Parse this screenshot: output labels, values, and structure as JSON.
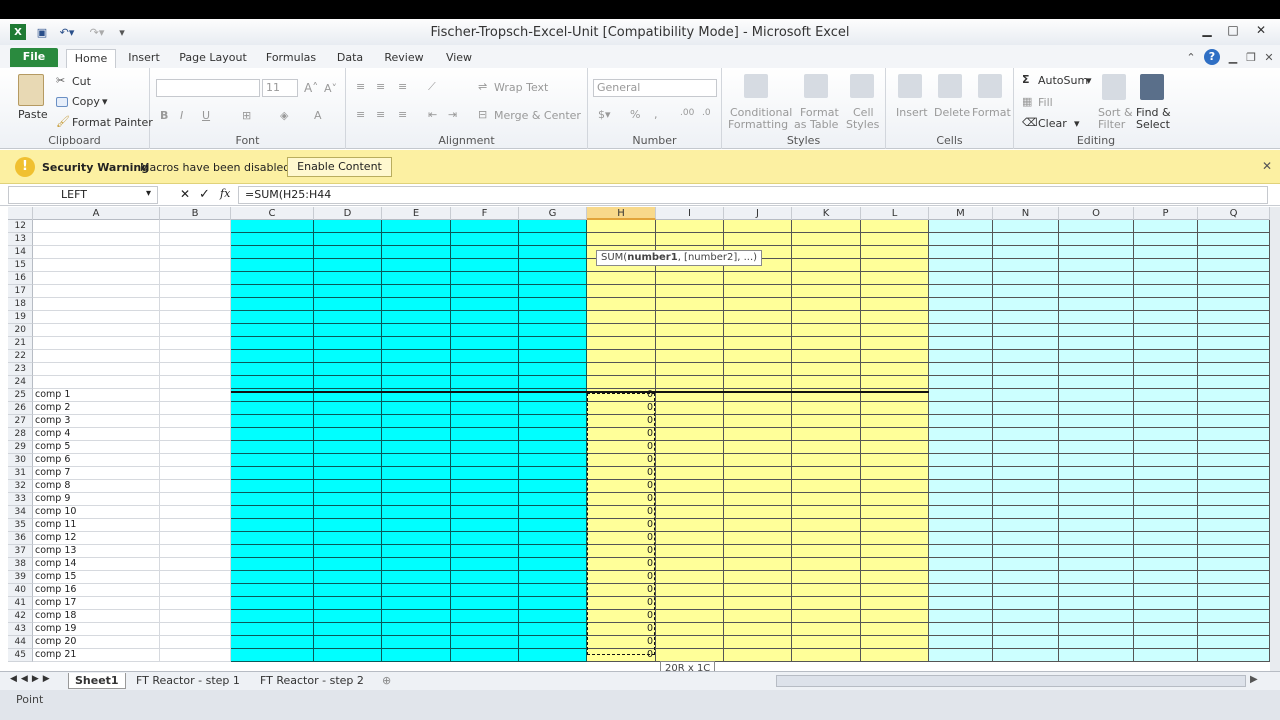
{
  "title": "Fischer-Tropsch-Excel-Unit  [Compatibility Mode] - Microsoft Excel",
  "tabs": [
    "File",
    "Home",
    "Insert",
    "Page Layout",
    "Formulas",
    "Data",
    "Review",
    "View"
  ],
  "ribbon": {
    "clipboard": {
      "paste": "Paste",
      "cut": "Cut",
      "copy": "Copy",
      "painter": "Format Painter",
      "label": "Clipboard"
    },
    "font": {
      "size": "11",
      "label": "Font"
    },
    "alignment": {
      "wrap": "Wrap Text",
      "merge": "Merge & Center",
      "label": "Alignment"
    },
    "number": {
      "format": "General",
      "label": "Number"
    },
    "styles": {
      "cond1": "Conditional",
      "cond2": "Formatting",
      "fmt1": "Format",
      "fmt2": "as Table",
      "cell1": "Cell",
      "cell2": "Styles",
      "label": "Styles"
    },
    "cells": {
      "insert": "Insert",
      "delete": "Delete",
      "format": "Format",
      "label": "Cells"
    },
    "editing": {
      "autosum": "AutoSum",
      "fill": "Fill",
      "clear": "Clear",
      "sort1": "Sort &",
      "sort2": "Filter",
      "find1": "Find &",
      "find2": "Select",
      "label": "Editing"
    }
  },
  "warning": {
    "title": "Security Warning",
    "message": "Macros have been disabled.",
    "button": "Enable Content"
  },
  "formula_bar": {
    "name": "LEFT",
    "formula": "=SUM(H25:H44"
  },
  "columns": [
    "A",
    "B",
    "C",
    "D",
    "E",
    "F",
    "G",
    "H",
    "I",
    "J",
    "K",
    "L",
    "M",
    "N",
    "O",
    "P",
    "Q"
  ],
  "rows_top": [
    "12",
    "13",
    "14",
    "15",
    "16",
    "17",
    "18",
    "19",
    "20",
    "21",
    "22",
    "23",
    "24"
  ],
  "rows_comp": [
    {
      "n": "25",
      "a": "comp 1",
      "h": "0"
    },
    {
      "n": "26",
      "a": "comp 2",
      "h": "0"
    },
    {
      "n": "27",
      "a": "comp 3",
      "h": "0"
    },
    {
      "n": "28",
      "a": "comp 4",
      "h": "0"
    },
    {
      "n": "29",
      "a": "comp 5",
      "h": "0"
    },
    {
      "n": "30",
      "a": "comp 6",
      "h": "0"
    },
    {
      "n": "31",
      "a": "comp 7",
      "h": "0"
    },
    {
      "n": "32",
      "a": "comp 8",
      "h": "0"
    },
    {
      "n": "33",
      "a": "comp 9",
      "h": "0"
    },
    {
      "n": "34",
      "a": "comp 10",
      "h": "0"
    },
    {
      "n": "35",
      "a": "comp 11",
      "h": "0"
    },
    {
      "n": "36",
      "a": "comp 12",
      "h": "0"
    },
    {
      "n": "37",
      "a": "comp 13",
      "h": "0"
    },
    {
      "n": "38",
      "a": "comp 14",
      "h": "0"
    },
    {
      "n": "39",
      "a": "comp 15",
      "h": "0"
    },
    {
      "n": "40",
      "a": "comp 16",
      "h": "0"
    },
    {
      "n": "41",
      "a": "comp 17",
      "h": "0"
    },
    {
      "n": "42",
      "a": "comp 18",
      "h": "0"
    },
    {
      "n": "43",
      "a": "comp 19",
      "h": "0"
    },
    {
      "n": "44",
      "a": "comp 20",
      "h": "0"
    },
    {
      "n": "45",
      "a": "comp 21",
      "h": "0"
    }
  ],
  "tooltip": {
    "prefix": "SUM(",
    "bold": "number1",
    "suffix": ", [number2], ...)"
  },
  "size_tip": "20R x 1C",
  "sheets": [
    "Sheet1",
    "FT Reactor - step 1",
    "FT Reactor - step 2"
  ],
  "status": "Point",
  "colors": {
    "cyan": "#00ffff",
    "yellow": "#ffff99",
    "light_cyan": "#ccffff",
    "warning": "#fcf0a2"
  }
}
